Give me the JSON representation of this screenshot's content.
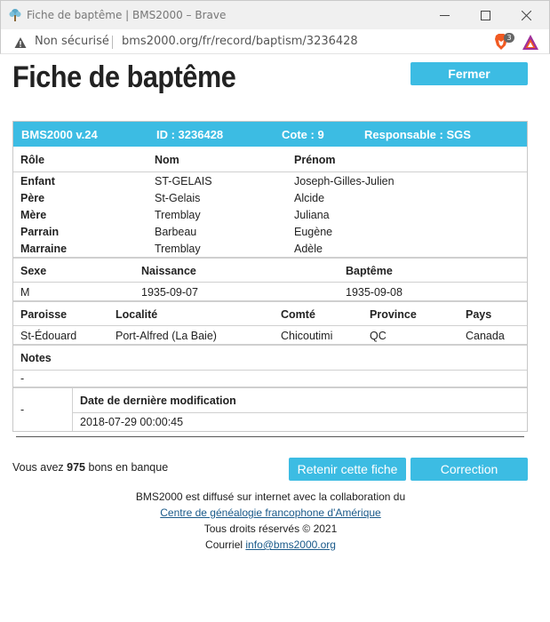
{
  "window": {
    "title": "Fiche de baptême | BMS2000 – Brave",
    "not_secure": "Non sécurisé",
    "url": "bms2000.org/fr/record/baptism/3236428",
    "brave_badge": "3"
  },
  "page": {
    "title": "Fiche de baptême",
    "close_label": "Fermer"
  },
  "record": {
    "header": {
      "version": "BMS2000 v.24",
      "id": "ID : 3236428",
      "cote": "Cote : 9",
      "responsable": "Responsable : SGS"
    },
    "persons_headers": [
      "Rôle",
      "Nom",
      "Prénom"
    ],
    "persons": [
      {
        "role": "Enfant",
        "nom": "ST-GELAIS",
        "prenom": "Joseph-Gilles-Julien"
      },
      {
        "role": "Père",
        "nom": "St-Gelais",
        "prenom": "Alcide"
      },
      {
        "role": "Mère",
        "nom": "Tremblay",
        "prenom": "Juliana"
      },
      {
        "role": "Parrain",
        "nom": "Barbeau",
        "prenom": "Eugène"
      },
      {
        "role": "Marraine",
        "nom": "Tremblay",
        "prenom": "Adèle"
      }
    ],
    "vital_headers": [
      "Sexe",
      "Naissance",
      "Baptême"
    ],
    "vital": {
      "sexe": "M",
      "naissance": "1935-09-07",
      "bapteme": "1935-09-08"
    },
    "place_headers": [
      "Paroisse",
      "Localité",
      "Comté",
      "Province",
      "Pays"
    ],
    "place": {
      "paroisse": "St-Édouard",
      "localite": "Port-Alfred (La Baie)",
      "comte": "Chicoutimi",
      "province": "QC",
      "pays": "Canada"
    },
    "notes_header": "Notes",
    "notes_value": "-",
    "mod_left": "-",
    "mod_header": "Date de dernière modification",
    "mod_value": "2018-07-29 00:00:45"
  },
  "bank": {
    "prefix": "Vous avez ",
    "count": "975",
    "suffix": " bons en banque"
  },
  "actions": {
    "keep_label": "Retenir cette fiche",
    "correct_label": "Correction"
  },
  "footer": {
    "line1": "BMS2000 est diffusé sur internet avec la collaboration du",
    "link1": "Centre de généalogie francophone d'Amérique",
    "line3": "Tous droits réservés © 2021",
    "email_prefix": "Courriel ",
    "email": "info@bms2000.org"
  },
  "colors": {
    "accent": "#3cbce3",
    "link": "#1a5a8a"
  },
  "icons": [
    "app-tree-icon",
    "minimize-icon",
    "maximize-icon",
    "close-icon",
    "warning-icon",
    "brave-lion-icon",
    "brave-rewards-icon"
  ]
}
